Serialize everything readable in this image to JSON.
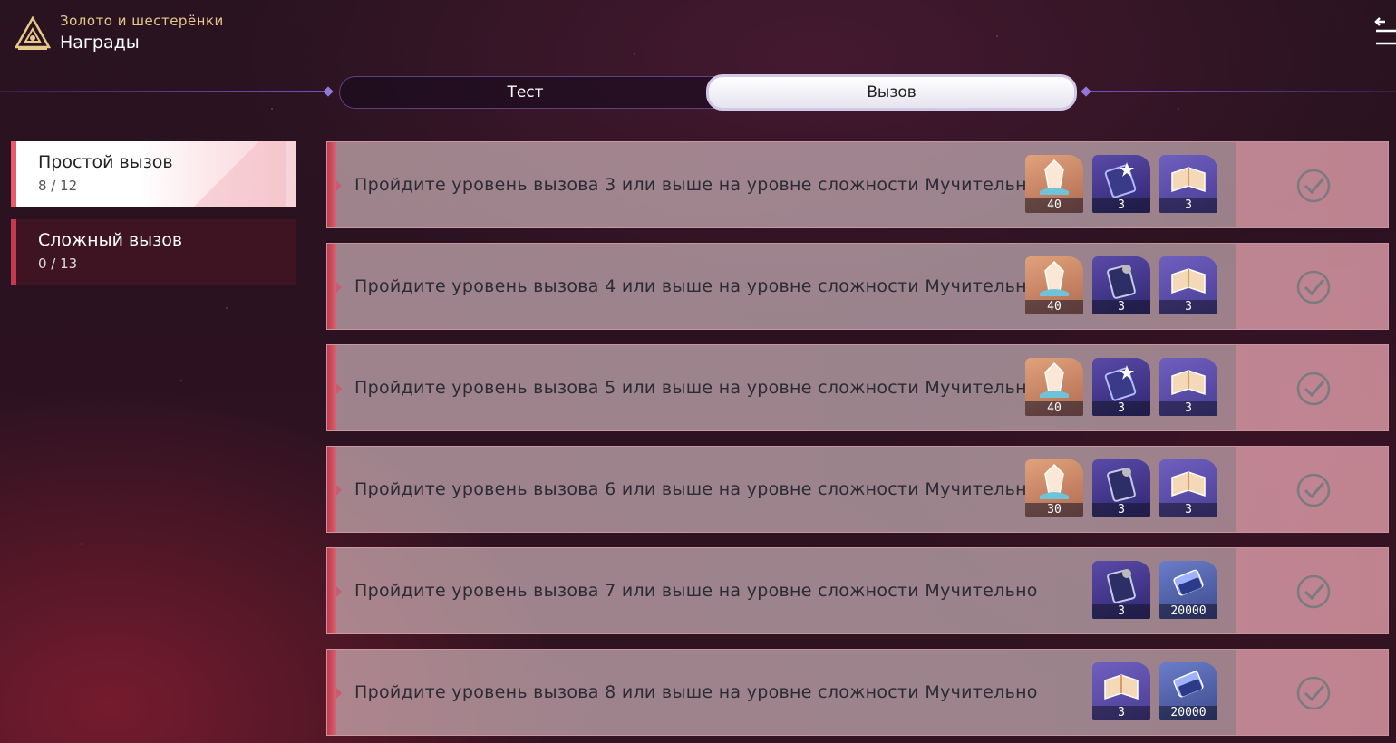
{
  "header": {
    "subtitle": "Золото и шестерёнки",
    "title": "Награды"
  },
  "tabs": [
    {
      "label": "Тест",
      "active": false
    },
    {
      "label": "Вызов",
      "active": true
    }
  ],
  "categories": [
    {
      "name": "Простой вызов",
      "count": "8 / 12",
      "active": true
    },
    {
      "name": "Сложный вызов",
      "count": "0 / 13",
      "active": false
    }
  ],
  "tasks": [
    {
      "text": "Пройдите уровень вызова 3 или выше на уровне сложности Мучительно",
      "rewards": [
        {
          "icon": "crystal-icon",
          "qty": "40"
        },
        {
          "icon": "star-pass-icon",
          "qty": "3"
        },
        {
          "icon": "book-icon",
          "qty": "3"
        }
      ],
      "completed": true
    },
    {
      "text": "Пройдите уровень вызова 4 или выше на уровне сложности Мучительно",
      "rewards": [
        {
          "icon": "crystal-icon",
          "qty": "40"
        },
        {
          "icon": "rail-pass-icon",
          "qty": "3"
        },
        {
          "icon": "book-icon",
          "qty": "3"
        }
      ],
      "completed": true
    },
    {
      "text": "Пройдите уровень вызова 5 или выше на уровне сложности Мучительно",
      "rewards": [
        {
          "icon": "crystal-icon",
          "qty": "40"
        },
        {
          "icon": "star-pass-icon",
          "qty": "3"
        },
        {
          "icon": "book-icon",
          "qty": "3"
        }
      ],
      "completed": true
    },
    {
      "text": "Пройдите уровень вызова 6 или выше на уровне сложности Мучительно",
      "rewards": [
        {
          "icon": "crystal-icon",
          "qty": "30"
        },
        {
          "icon": "rail-pass-icon",
          "qty": "3"
        },
        {
          "icon": "book-icon",
          "qty": "3"
        }
      ],
      "completed": true
    },
    {
      "text": "Пройдите уровень вызова 7 или выше на уровне сложности Мучительно",
      "rewards": [
        {
          "icon": "rail-pass-icon",
          "qty": "3"
        },
        {
          "icon": "credit-icon",
          "qty": "20000"
        }
      ],
      "completed": true
    },
    {
      "text": "Пройдите уровень вызова 8 или выше на уровне сложности Мучительно",
      "rewards": [
        {
          "icon": "book-icon",
          "qty": "3"
        },
        {
          "icon": "credit-icon",
          "qty": "20000"
        }
      ],
      "completed": true
    }
  ],
  "colors": {
    "accent": "#c23a4c",
    "gold": "#e6c98a",
    "tab_border": "#8f78d8"
  }
}
